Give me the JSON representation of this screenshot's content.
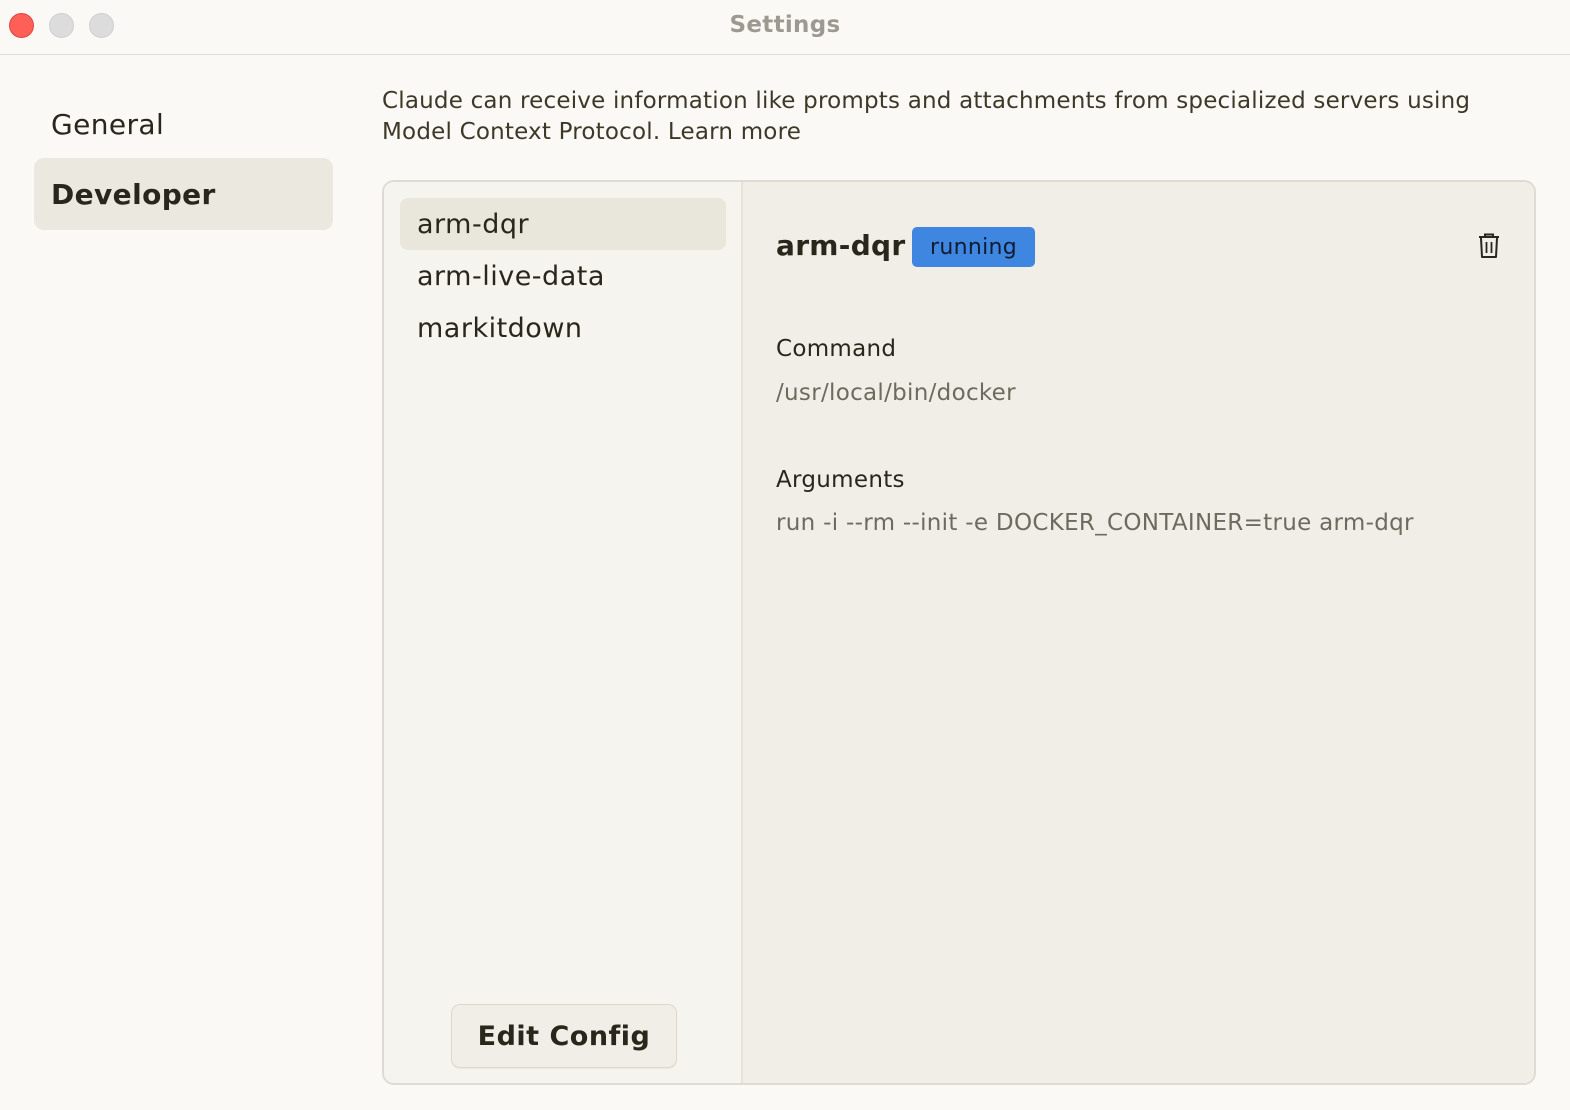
{
  "window": {
    "title": "Settings"
  },
  "sidebar": {
    "items": [
      {
        "label": "General",
        "selected": false
      },
      {
        "label": "Developer",
        "selected": true
      }
    ]
  },
  "description": {
    "text": "Claude can receive information like prompts and attachments from specialized servers using Model Context Protocol.",
    "link_label": "Learn more"
  },
  "servers": {
    "items": [
      {
        "label": "arm-dqr",
        "selected": true
      },
      {
        "label": "arm-live-data",
        "selected": false
      },
      {
        "label": "markitdown",
        "selected": false
      }
    ],
    "edit_config_label": "Edit Config"
  },
  "detail": {
    "name": "arm-dqr",
    "status": "running",
    "status_color": "#3f86e0",
    "command_label": "Command",
    "command_value": "/usr/local/bin/docker",
    "arguments_label": "Arguments",
    "arguments_value": "run -i --rm --init -e DOCKER_CONTAINER=true arm-dqr",
    "delete_icon": "trash-icon"
  }
}
